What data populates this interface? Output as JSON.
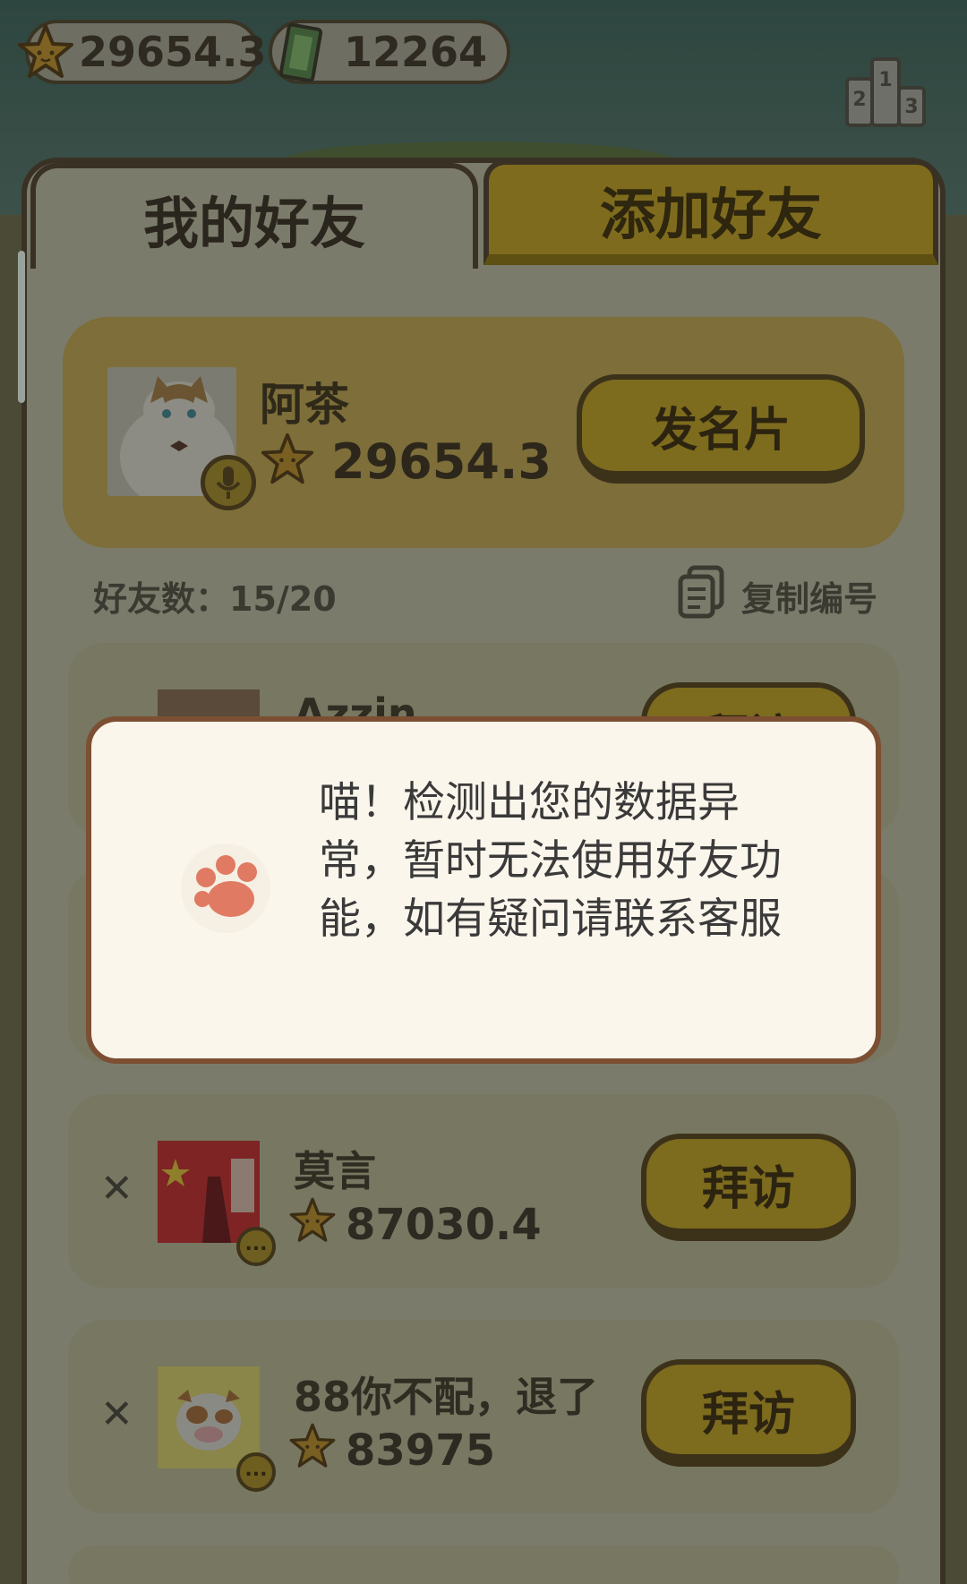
{
  "currency": {
    "stars": "29654.3",
    "cash": "12264"
  },
  "tabs": [
    {
      "label": "我的好友",
      "active": true
    },
    {
      "label": "添加好友",
      "active": false
    }
  ],
  "self": {
    "name": "阿茶",
    "score": "29654.3",
    "card_button": "发名片"
  },
  "friend_count": "好友数：15/20",
  "copy_label": "复制编号",
  "friends": [
    {
      "name": "Azzin",
      "score": "",
      "button": "拜访",
      "avatar_color": "#5a4a3a"
    },
    {
      "name": "",
      "score": "",
      "button": "",
      "avatar_color": "#777762"
    },
    {
      "name": "莫言",
      "score": "87030.4",
      "button": "拜访",
      "avatar_color": "#8a2a2a"
    },
    {
      "name": "88你不配，退了",
      "score": "83975",
      "button": "拜访",
      "avatar_color": "#8c8a4a"
    }
  ],
  "modal": {
    "message": "喵！检测出您的数据异常，暂时无法使用好友功能，如有疑问请联系客服"
  },
  "badge_dots": "..."
}
